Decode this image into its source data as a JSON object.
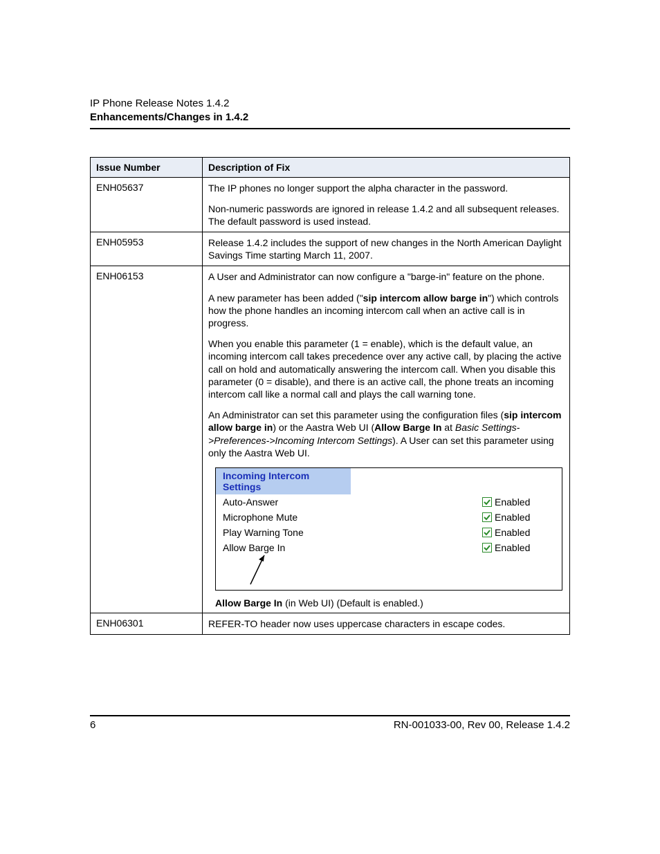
{
  "header": {
    "title": "IP Phone Release Notes 1.4.2",
    "subtitle": "Enhancements/Changes in 1.4.2"
  },
  "table": {
    "col_issue": "Issue Number",
    "col_desc": "Description of Fix",
    "rows": {
      "r0": {
        "issue": "ENH05637",
        "p1": "The IP phones no longer support the alpha character in the password.",
        "p2": "Non-numeric passwords are ignored in release 1.4.2 and all subsequent releases. The default password is used instead."
      },
      "r1": {
        "issue": "ENH05953",
        "p1": "Release 1.4.2 includes the support of new changes in the North American Daylight Savings Time starting March 11, 2007."
      },
      "r2": {
        "issue": "ENH06153",
        "p1": "A User and Administrator can now configure a \"barge-in\" feature on the phone.",
        "p2a": "A new parameter has been added (\"",
        "p2b": "sip intercom allow barge in",
        "p2c": "\") which controls how the phone handles an incoming intercom call when an active call is in progress.",
        "p3": "When you enable this parameter (1 = enable), which is the default value, an incoming intercom call takes precedence over any active call, by placing the active call on hold and automatically answering the intercom call. When you disable this parameter (0 = disable), and there is an active call, the phone treats an incoming intercom call like a normal call and plays the call warning tone.",
        "p4a": "An Administrator can set this parameter using the configuration files (",
        "p4b": "sip intercom allow barge in",
        "p4c": ") or the Aastra Web UI (",
        "p4d": "Allow Barge In",
        "p4e": " at ",
        "p4f": "Basic Settings->Preferences->Incoming Intercom Settings",
        "p4g": "). A User can set this parameter using only the Aastra Web UI.",
        "ui": {
          "title": "Incoming Intercom Settings",
          "rows": {
            "r0": {
              "label": "Auto-Answer",
              "state": "Enabled"
            },
            "r1": {
              "label": "Microphone Mute",
              "state": "Enabled"
            },
            "r2": {
              "label": "Play Warning Tone",
              "state": "Enabled"
            },
            "r3": {
              "label": "Allow Barge In",
              "state": "Enabled"
            }
          }
        },
        "caption_b": "Allow Barge In",
        "caption_rest": " (in Web UI) (Default is enabled.)"
      },
      "r3": {
        "issue": "ENH06301",
        "p1": "REFER-TO header now uses uppercase characters in escape codes."
      }
    }
  },
  "footer": {
    "page": "6",
    "doc": "RN-001033-00, Rev 00, Release 1.4.2"
  }
}
